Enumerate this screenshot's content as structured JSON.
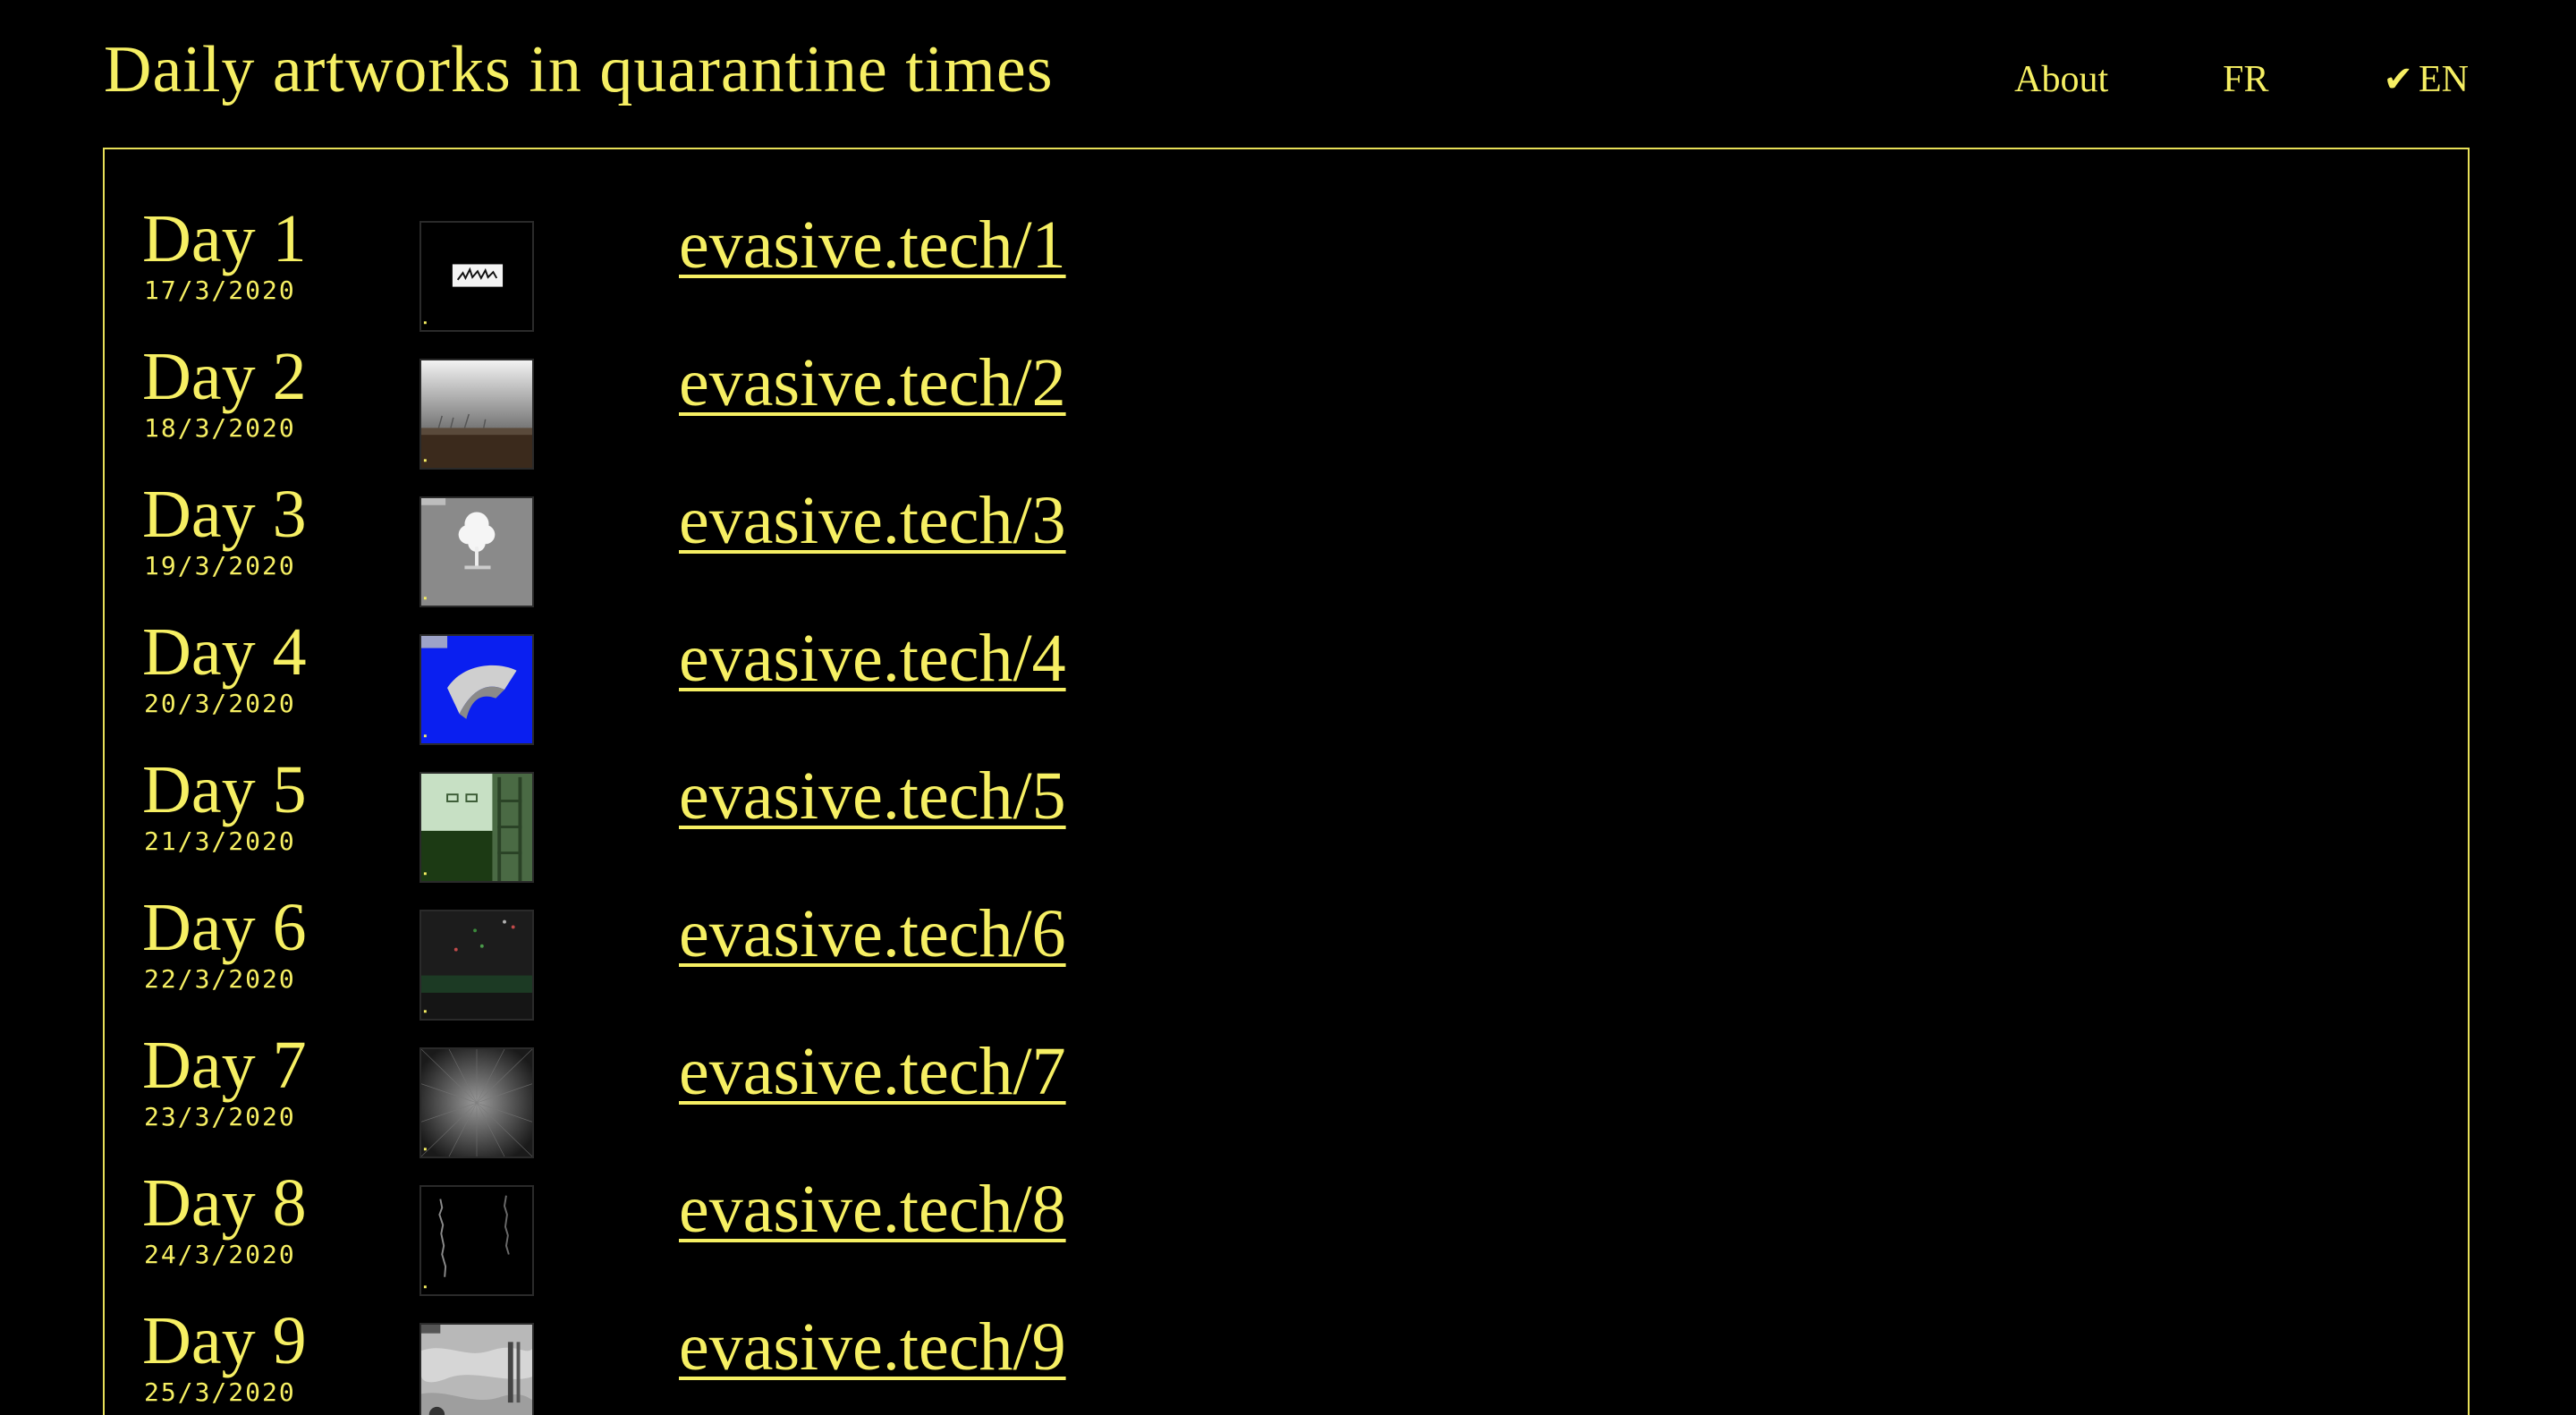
{
  "site": {
    "title": "Daily artworks in quarantine times"
  },
  "nav": {
    "about": "About",
    "fr": "FR",
    "en_check": "✔",
    "en": "EN"
  },
  "colors": {
    "accent": "#f6ef63",
    "background": "#000000"
  },
  "entries": [
    {
      "day": "Day 1",
      "date": "17/3/2020",
      "link": "evasive.tech/1",
      "thumb": "white-strip-with-birds-on-black"
    },
    {
      "day": "Day 2",
      "date": "18/3/2020",
      "link": "evasive.tech/2",
      "thumb": "grey-sky-over-brown-ground"
    },
    {
      "day": "Day 3",
      "date": "19/3/2020",
      "link": "evasive.tech/3",
      "thumb": "white-tree-on-grey"
    },
    {
      "day": "Day 4",
      "date": "20/3/2020",
      "link": "evasive.tech/4",
      "thumb": "grey-shape-on-blue"
    },
    {
      "day": "Day 5",
      "date": "21/3/2020",
      "link": "evasive.tech/5",
      "thumb": "green-room-with-ladder"
    },
    {
      "day": "Day 6",
      "date": "22/3/2020",
      "link": "evasive.tech/6",
      "thumb": "dark-texture-with-colored-dots"
    },
    {
      "day": "Day 7",
      "date": "23/3/2020",
      "link": "evasive.tech/7",
      "thumb": "radial-light-burst"
    },
    {
      "day": "Day 8",
      "date": "24/3/2020",
      "link": "evasive.tech/8",
      "thumb": "faint-vertical-scribbles-on-black"
    },
    {
      "day": "Day 9",
      "date": "25/3/2020",
      "link": "evasive.tech/9",
      "thumb": "grey-marbled-texture"
    }
  ]
}
